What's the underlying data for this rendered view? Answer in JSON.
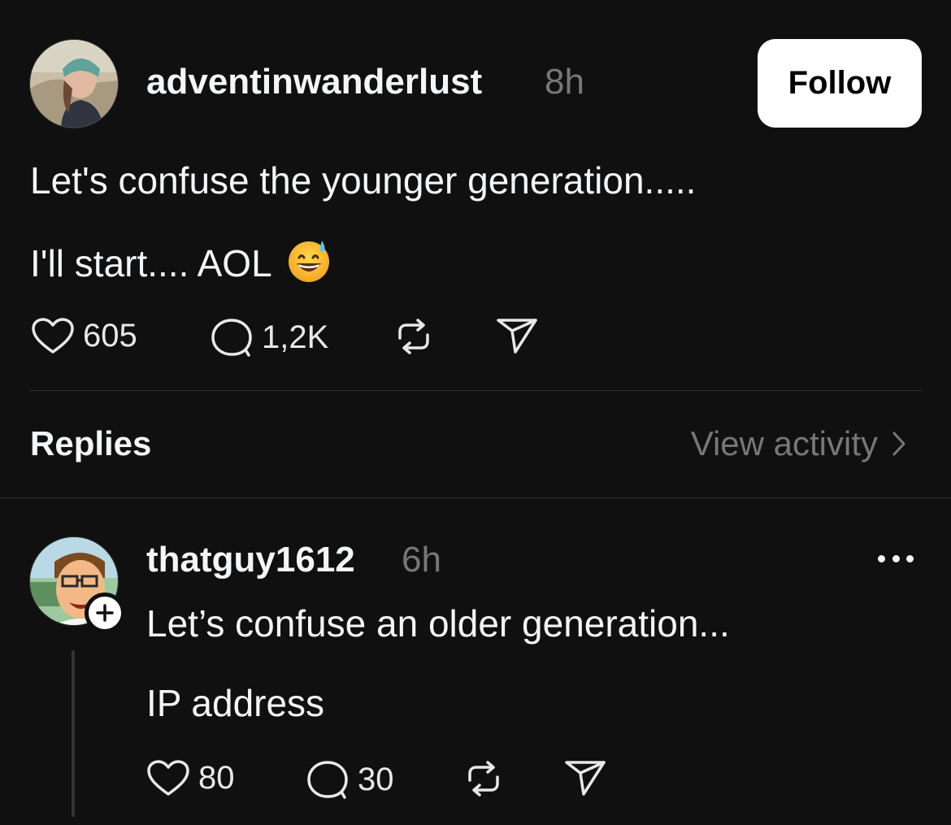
{
  "post": {
    "username": "adventinwanderlust",
    "time": "8h",
    "follow_label": "Follow",
    "text_line1": "Let's confuse the younger generation.....",
    "text_line2": "I'll start.... AOL",
    "emoji": "grinning-face-with-sweat-emoji",
    "likes": "605",
    "comments": "1,2K"
  },
  "section": {
    "replies_label": "Replies",
    "view_activity_label": "View activity"
  },
  "reply": {
    "username": "thatguy1612",
    "time": "6h",
    "text_line1": "Let’s confuse an older generation...",
    "text_line2": "IP address",
    "likes": "80",
    "comments": "30"
  },
  "icons": {
    "like": "heart-icon",
    "comment": "comment-bubble-icon",
    "repost": "repost-icon",
    "share": "send-icon",
    "more": "more-options-icon",
    "chevron": "chevron-right-icon",
    "plus": "plus-icon"
  },
  "colors": {
    "background": "#101010",
    "text_primary": "#f3f5f7",
    "text_secondary": "#777777",
    "divider": "#333333",
    "follow_bg": "#ffffff"
  }
}
